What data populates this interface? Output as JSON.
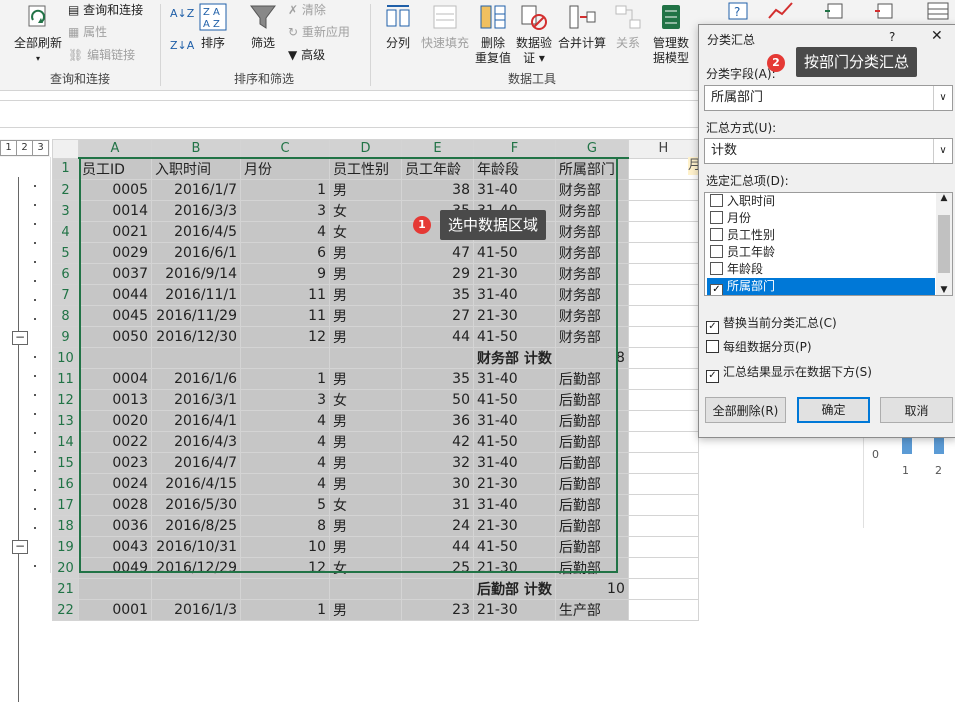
{
  "ribbon": {
    "refresh_all": "全部刷新",
    "query_connect": "查询和连接",
    "properties": "属性",
    "edit_links": "编辑链接",
    "group_query": "查询和连接",
    "sort": "排序",
    "filter": "筛选",
    "clear": "清除",
    "reapply": "重新应用",
    "advanced": "高级",
    "group_sort": "排序和筛选",
    "split": "分列",
    "flash_fill": "快速填充",
    "remove_dup_1": "删除",
    "remove_dup_2": "重复值",
    "validation_1": "数据验",
    "validation_2": "证",
    "consolidate": "合并计算",
    "relations": "关系",
    "model_1": "管理数",
    "model_2": "据模型",
    "group_tools": "数据工具"
  },
  "sheet": {
    "columns": [
      "A",
      "B",
      "C",
      "D",
      "E",
      "F",
      "G",
      "H"
    ],
    "header": [
      "员工ID",
      "入职时间",
      "月份",
      "员工性别",
      "员工年龄",
      "年龄段",
      "所属部门"
    ],
    "rows": [
      {
        "n": "2",
        "c": [
          "0005",
          "2016/1/7",
          "1",
          "男",
          "38",
          "31-40",
          "财务部"
        ]
      },
      {
        "n": "3",
        "c": [
          "0014",
          "2016/3/3",
          "3",
          "女",
          "35",
          "31-40",
          "财务部"
        ]
      },
      {
        "n": "4",
        "c": [
          "0021",
          "2016/4/5",
          "4",
          "女",
          "35",
          "31-40",
          "财务部"
        ]
      },
      {
        "n": "5",
        "c": [
          "0029",
          "2016/6/1",
          "6",
          "男",
          "47",
          "41-50",
          "财务部"
        ]
      },
      {
        "n": "6",
        "c": [
          "0037",
          "2016/9/14",
          "9",
          "男",
          "29",
          "21-30",
          "财务部"
        ]
      },
      {
        "n": "7",
        "c": [
          "0044",
          "2016/11/1",
          "11",
          "男",
          "35",
          "31-40",
          "财务部"
        ]
      },
      {
        "n": "8",
        "c": [
          "0045",
          "2016/11/29",
          "11",
          "男",
          "27",
          "21-30",
          "财务部"
        ]
      },
      {
        "n": "9",
        "c": [
          "0050",
          "2016/12/30",
          "12",
          "男",
          "44",
          "41-50",
          "财务部"
        ]
      },
      {
        "n": "10",
        "sub": true,
        "label": "财务部 计数",
        "count": "8"
      },
      {
        "n": "11",
        "c": [
          "0004",
          "2016/1/6",
          "1",
          "男",
          "35",
          "31-40",
          "后勤部"
        ]
      },
      {
        "n": "12",
        "c": [
          "0013",
          "2016/3/1",
          "3",
          "女",
          "50",
          "41-50",
          "后勤部"
        ]
      },
      {
        "n": "13",
        "c": [
          "0020",
          "2016/4/1",
          "4",
          "男",
          "36",
          "31-40",
          "后勤部"
        ]
      },
      {
        "n": "14",
        "c": [
          "0022",
          "2016/4/3",
          "4",
          "男",
          "42",
          "41-50",
          "后勤部"
        ]
      },
      {
        "n": "15",
        "c": [
          "0023",
          "2016/4/7",
          "4",
          "男",
          "32",
          "31-40",
          "后勤部"
        ]
      },
      {
        "n": "16",
        "c": [
          "0024",
          "2016/4/15",
          "4",
          "男",
          "30",
          "21-30",
          "后勤部"
        ]
      },
      {
        "n": "17",
        "c": [
          "0028",
          "2016/5/30",
          "5",
          "女",
          "31",
          "31-40",
          "后勤部"
        ]
      },
      {
        "n": "18",
        "c": [
          "0036",
          "2016/8/25",
          "8",
          "男",
          "24",
          "21-30",
          "后勤部"
        ]
      },
      {
        "n": "19",
        "c": [
          "0043",
          "2016/10/31",
          "10",
          "男",
          "44",
          "41-50",
          "后勤部"
        ]
      },
      {
        "n": "20",
        "c": [
          "0049",
          "2016/12/29",
          "12",
          "女",
          "25",
          "21-30",
          "后勤部"
        ]
      },
      {
        "n": "21",
        "sub": true,
        "label": "后勤部 计数",
        "count": "10"
      },
      {
        "n": "22",
        "c": [
          "0001",
          "2016/1/3",
          "1",
          "男",
          "23",
          "21-30",
          "生产部"
        ]
      }
    ],
    "outline_levels": [
      "1",
      "2",
      "3"
    ],
    "side_chart_labels": [
      "0",
      "1",
      "2"
    ],
    "side_col_i_fragment": "月"
  },
  "callouts": {
    "one_num": "1",
    "one_text": "选中数据区域",
    "two_num": "2",
    "two_text": "按部门分类汇总"
  },
  "dialog": {
    "title": "分类汇总",
    "help": "?",
    "close": "✕",
    "field_label": "分类字段(A):",
    "field_value": "所属部门",
    "func_label": "汇总方式(U):",
    "func_value": "计数",
    "items_label": "选定汇总项(D):",
    "items": [
      {
        "label": "入职时间",
        "checked": false
      },
      {
        "label": "月份",
        "checked": false
      },
      {
        "label": "员工性别",
        "checked": false
      },
      {
        "label": "员工年龄",
        "checked": false
      },
      {
        "label": "年龄段",
        "checked": false
      },
      {
        "label": "所属部门",
        "checked": true
      }
    ],
    "opt_replace": "替换当前分类汇总(C)",
    "opt_pagebreak": "每组数据分页(P)",
    "opt_below": "汇总结果显示在数据下方(S)",
    "btn_remove_all": "全部删除(R)",
    "btn_ok": "确定",
    "btn_cancel": "取消"
  }
}
